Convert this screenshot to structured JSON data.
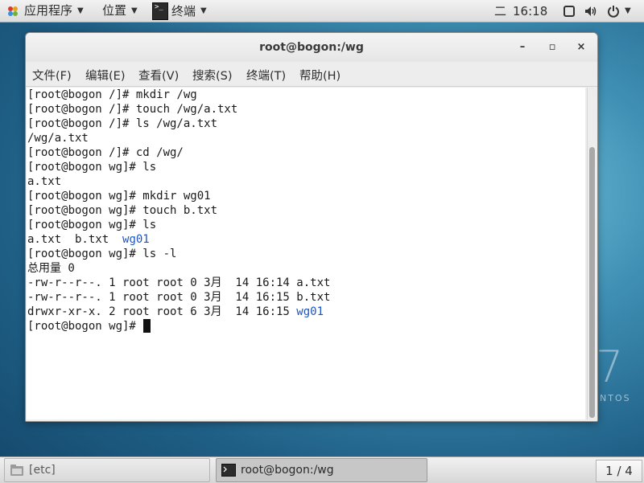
{
  "topbar": {
    "apps_label": "应用程序",
    "places_label": "位置",
    "terminal_task_label": "终端",
    "weekday": "二",
    "time": "16:18"
  },
  "window": {
    "title": "root@bogon:/wg",
    "minimize": "–",
    "maximize": "▫",
    "close": "×",
    "menu": [
      "文件(F)",
      "编辑(E)",
      "查看(V)",
      "搜索(S)",
      "终端(T)",
      "帮助(H)"
    ]
  },
  "terminal": {
    "lines": [
      "[root@bogon /]# mkdir /wg",
      "[root@bogon /]# touch /wg/a.txt",
      "[root@bogon /]# ls /wg/a.txt",
      "/wg/a.txt",
      "[root@bogon /]# cd /wg/",
      "[root@bogon wg]# ls",
      "a.txt",
      "[root@bogon wg]# mkdir wg01",
      "[root@bogon wg]# touch b.txt",
      "[root@bogon wg]# ls",
      "a.txt  b.txt  ",
      "[root@bogon wg]# ls -l",
      "总用量 0",
      "-rw-r--r--. 1 root root 0 3月  14 16:14 a.txt",
      "-rw-r--r--. 1 root root 0 3月  14 16:15 b.txt",
      "drwxr-xr-x. 2 root root 6 3月  14 16:15 ",
      "[root@bogon wg]# "
    ],
    "dir_name": "wg01",
    "dir_color": "#1a56c2"
  },
  "desktop": {
    "watermark_number": "7",
    "watermark_text": "NTOS"
  },
  "bottombar": {
    "task1_label": "[etc]",
    "task2_label": "root@bogon:/wg",
    "workspace": "1 / 4"
  },
  "icons": {
    "apps": "apps-icon",
    "terminal": "terminal-icon",
    "display": "display-icon",
    "volume": "volume-icon",
    "power": "power-icon",
    "folder": "folder-icon"
  }
}
